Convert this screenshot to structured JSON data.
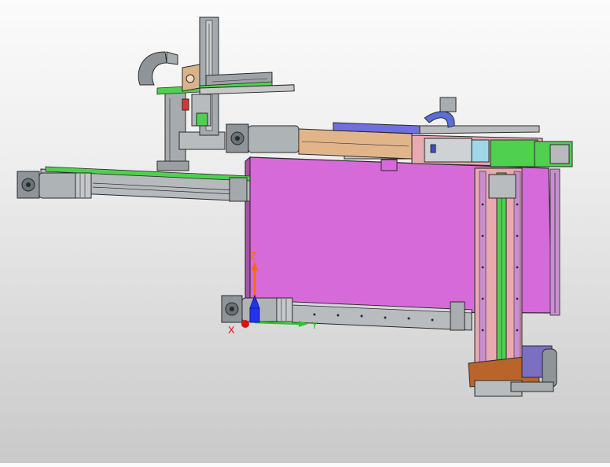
{
  "viewport": {
    "background_top": "#fbfbfb",
    "background_bottom": "#c9c9c9"
  },
  "triad": {
    "z_label": "Z",
    "y_label": "Y",
    "x_label": "X",
    "z_color": "#ff6600",
    "y_color": "#22cc22",
    "x_color": "#dd1111"
  },
  "colors": {
    "panel_magenta": "#d66ad8",
    "rail_green": "#4fd04f",
    "pink_frame": "#e8a9b0",
    "tan_beam": "#e2b48a",
    "blue_bar": "#6f6fe0",
    "steel_gray": "#9aa0a4",
    "dark_line": "#2a2a2a",
    "brown_block": "#b8642a",
    "purple_box": "#7b6fc2"
  }
}
